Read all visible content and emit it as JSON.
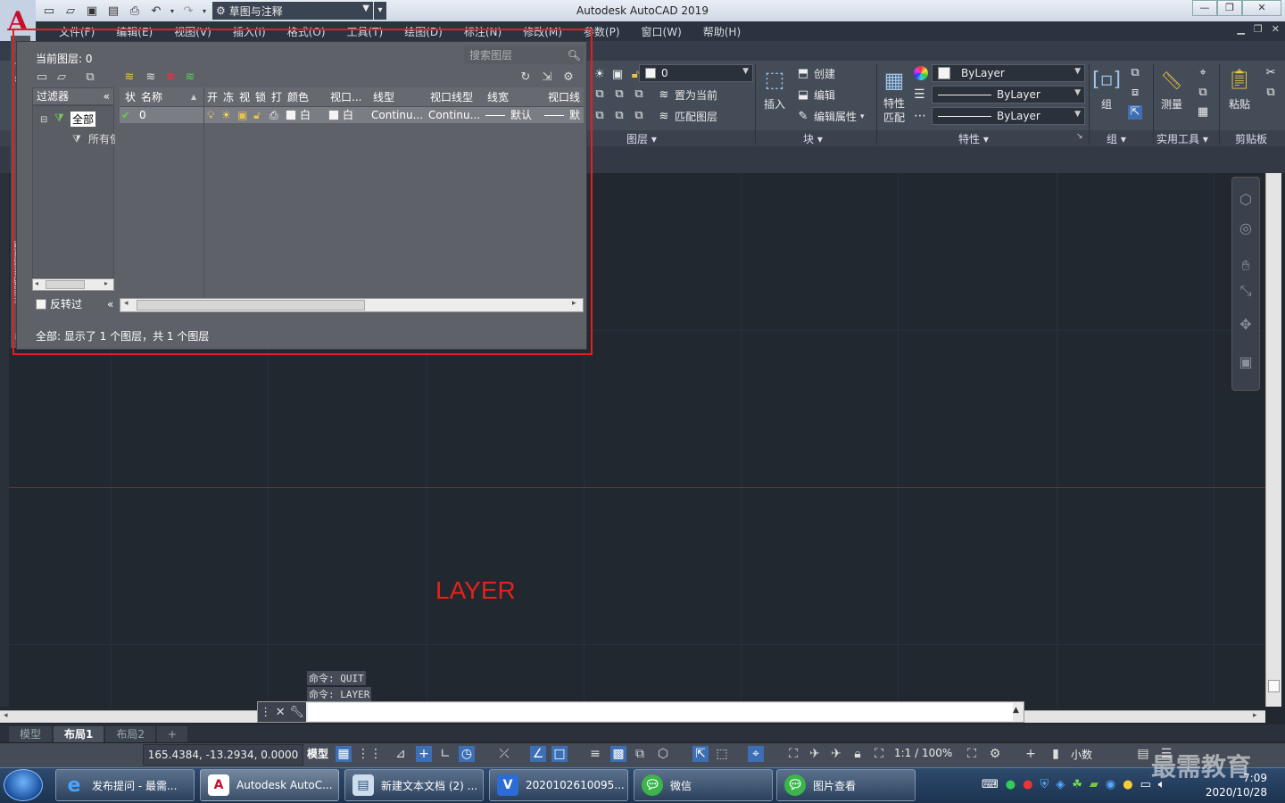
{
  "window": {
    "title": "Autodesk AutoCAD 2019",
    "workspace": "草图与注释"
  },
  "menubar": {
    "items": [
      "文件(F)",
      "编辑(E)",
      "视图(V)",
      "插入(I)",
      "格式(O)",
      "工具(T)",
      "绘图(D)",
      "标注(N)",
      "修改(M)",
      "参数(P)",
      "窗口(W)",
      "帮助(H)"
    ]
  },
  "ribbon": {
    "layers_panel": {
      "title": "图层",
      "current_layer": "0",
      "set_current": "置为当前",
      "match_layer": "匹配图层"
    },
    "block_panel": {
      "title": "块",
      "insert": "插入",
      "create": "创建",
      "edit": "编辑",
      "edit_attributes": "编辑属性"
    },
    "properties_panel": {
      "title": "特性",
      "match": "特性匹配",
      "color": "ByLayer",
      "linetype": "ByLayer",
      "lineweight": "ByLayer"
    },
    "group_panel": {
      "title": "组",
      "group": "组"
    },
    "utilities_panel": {
      "title": "实用工具",
      "measure": "测量"
    },
    "clipboard_panel": {
      "title": "剪贴板",
      "paste": "粘贴"
    }
  },
  "layer_palette": {
    "strip_title": "图层特性管理器",
    "current_layer_label": "当前图层: 0",
    "search_placeholder": "搜索图层",
    "filters_header": "过滤器",
    "filter_tree": [
      "全部",
      "所有使"
    ],
    "invert_label": "反转过",
    "columns": [
      "状",
      "名称",
      "开",
      "冻",
      "视",
      "锁",
      "打",
      "颜色",
      "视口...",
      "线型",
      "视口线型",
      "线宽",
      "视口线"
    ],
    "rows": [
      {
        "name": "0",
        "color": "白",
        "vp_color": "白",
        "linetype": "Continu...",
        "vp_linetype": "Continu...",
        "lineweight": "默认",
        "vp_lineweight": "默"
      }
    ],
    "status": "全部: 显示了 1 个图层，共 1 个图层"
  },
  "drawing": {
    "text_entity": "LAYER",
    "text_color": "#e3231b"
  },
  "command": {
    "history": [
      "命令: QUIT",
      "命令: LAYER"
    ]
  },
  "layout_tabs": [
    "模型",
    "布局1",
    "布局2"
  ],
  "statusbar": {
    "coords": "165.4384, -13.2934, 0.0000",
    "model": "模型",
    "scale": "1:1 / 100%",
    "units": "小数"
  },
  "taskbar": {
    "items": [
      "发布提问 - 最需...",
      "Autodesk AutoC...",
      "新建文本文档 (2) ...",
      "2020102610095...",
      "微信",
      "图片查看"
    ],
    "time": "7:09",
    "date": "2020/10/28",
    "watermark": "最需教育"
  }
}
